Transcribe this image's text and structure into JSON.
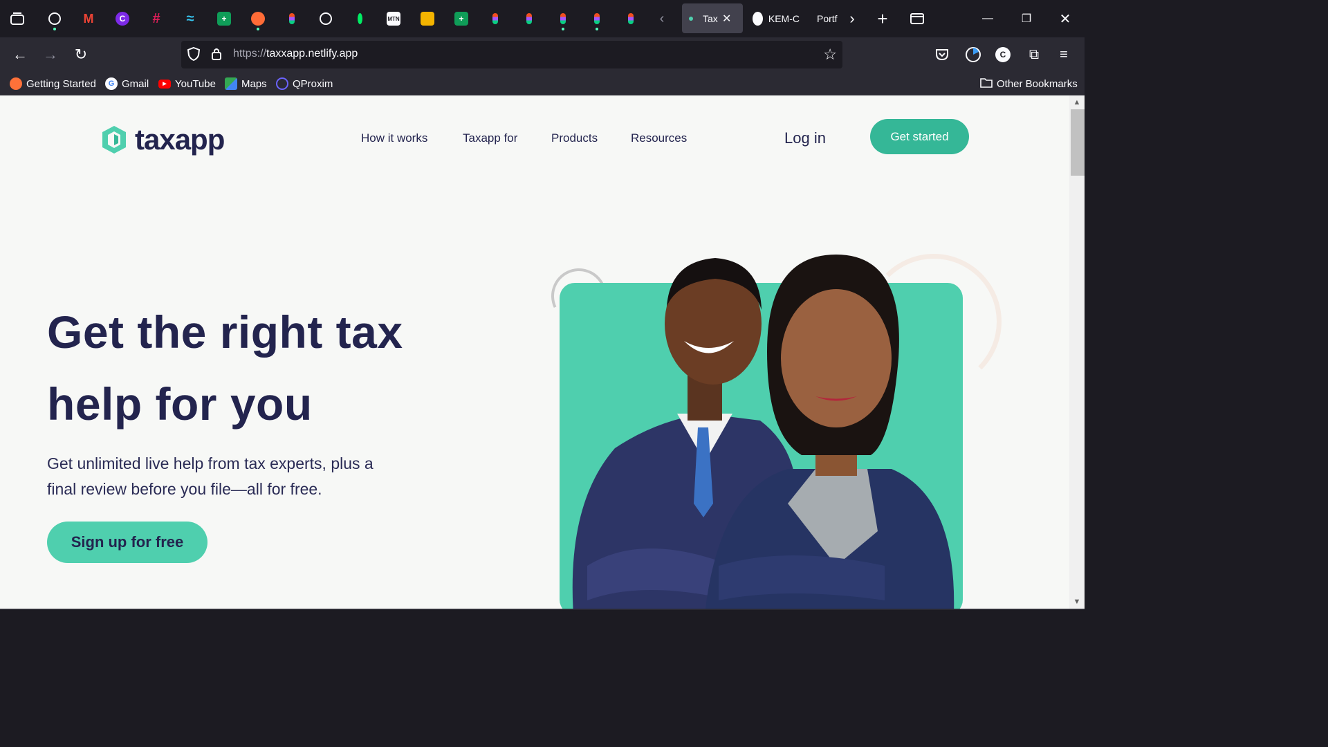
{
  "browser": {
    "tabs": {
      "active_title": "Tax",
      "tab2_title": "KEM-C",
      "tab3_title": "Portf"
    },
    "url": {
      "scheme": "https://",
      "host": "taxxapp.netlify.app"
    },
    "bookmarks": [
      {
        "label": "Getting Started"
      },
      {
        "label": "Gmail"
      },
      {
        "label": "YouTube"
      },
      {
        "label": "Maps"
      },
      {
        "label": "QProxim"
      }
    ],
    "other_bookmarks": "Other Bookmarks",
    "colors": {
      "tab_dot": "#54ffbd",
      "chrome_bg": "#1c1b22",
      "toolbar_bg": "#2b2a33"
    }
  },
  "site": {
    "logo_text": "taxapp",
    "nav": [
      "How it works",
      "Taxapp for",
      "Products",
      "Resources"
    ],
    "login": "Log in",
    "get_started": "Get started",
    "hero": {
      "title_line1": "Get the right tax",
      "title_line2": "help for you",
      "subtitle": "Get unlimited live help from tax experts, plus a final review before you file—all for free.",
      "cta": "Sign up for free"
    },
    "colors": {
      "brand": "#35b797",
      "brand_light": "#4fcfae",
      "text": "#23244e",
      "bg": "#f7f8f6"
    }
  }
}
